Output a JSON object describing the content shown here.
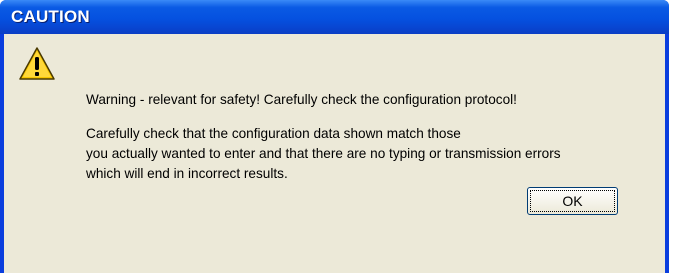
{
  "window": {
    "title": "CAUTION"
  },
  "message": {
    "headline": "Warning - relevant for safety! Carefully check the configuration protocol!",
    "lines": [
      "Carefully check that the configuration data shown match those",
      "you actually wanted to enter and that there are no typing or transmission errors",
      "which will end in incorrect results."
    ]
  },
  "buttons": {
    "ok_label": "OK"
  },
  "icon": {
    "name": "warning-icon",
    "color": "#f5c400"
  }
}
